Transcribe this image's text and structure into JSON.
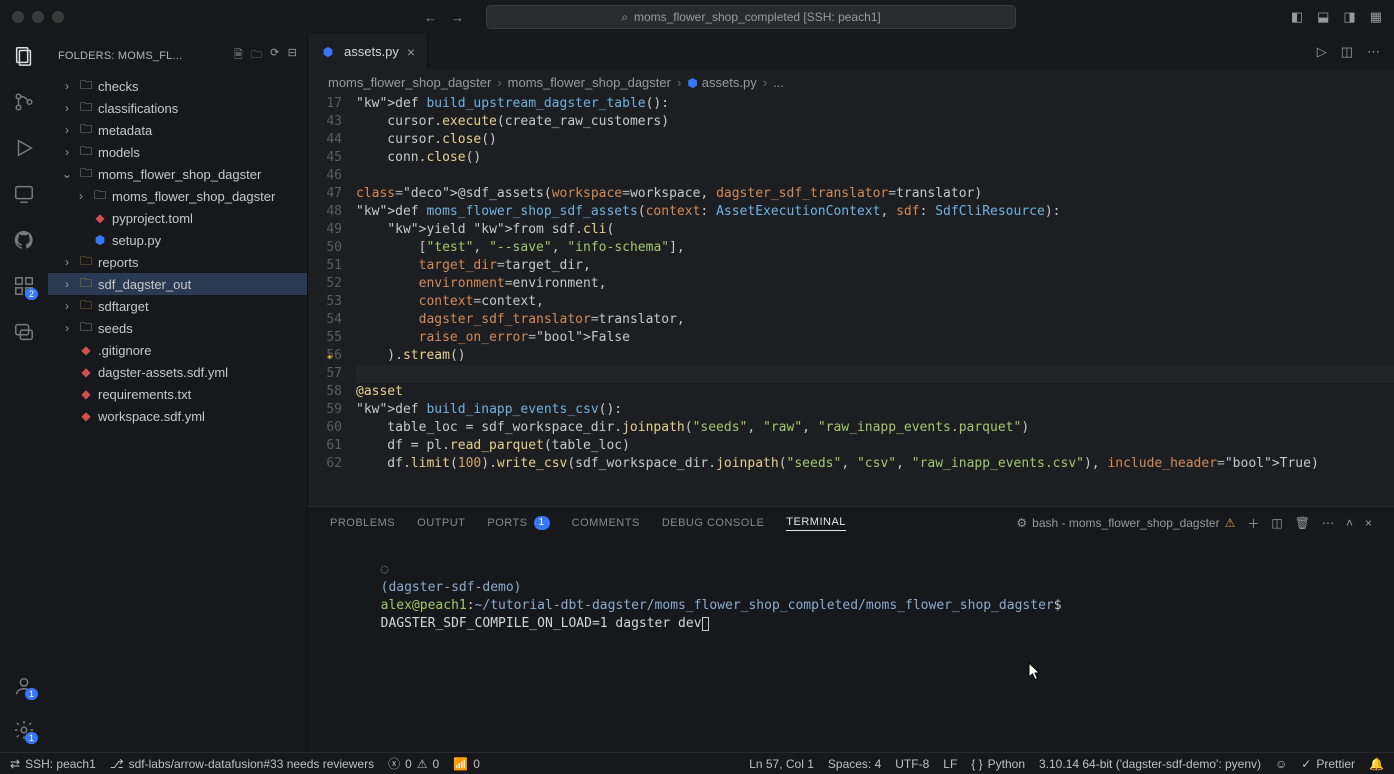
{
  "window": {
    "search_label": "moms_flower_shop_completed [SSH: peach1]"
  },
  "sidebar": {
    "header": "FOLDERS: MOMS_FL...",
    "tree": [
      {
        "indent": 0,
        "chev": "›",
        "icon": "folder",
        "label": "checks"
      },
      {
        "indent": 0,
        "chev": "›",
        "icon": "folder",
        "label": "classifications"
      },
      {
        "indent": 0,
        "chev": "›",
        "icon": "folder",
        "label": "metadata"
      },
      {
        "indent": 0,
        "chev": "›",
        "icon": "folder",
        "label": "models"
      },
      {
        "indent": 0,
        "chev": "⌄",
        "icon": "folder",
        "label": "moms_flower_shop_dagster"
      },
      {
        "indent": 1,
        "chev": "›",
        "icon": "folder",
        "label": "moms_flower_shop_dagster"
      },
      {
        "indent": 1,
        "chev": "",
        "icon": "yml",
        "label": "pyproject.toml"
      },
      {
        "indent": 1,
        "chev": "",
        "icon": "py",
        "label": "setup.py"
      },
      {
        "indent": 0,
        "chev": "›",
        "icon": "folder-y",
        "label": "reports"
      },
      {
        "indent": 0,
        "chev": "›",
        "icon": "folder-y",
        "label": "sdf_dagster_out",
        "selected": true
      },
      {
        "indent": 0,
        "chev": "›",
        "icon": "folder-y",
        "label": "sdftarget"
      },
      {
        "indent": 0,
        "chev": "›",
        "icon": "folder",
        "label": "seeds"
      },
      {
        "indent": 0,
        "chev": "",
        "icon": "yml",
        "label": ".gitignore"
      },
      {
        "indent": 0,
        "chev": "",
        "icon": "yml",
        "label": "dagster-assets.sdf.yml"
      },
      {
        "indent": 0,
        "chev": "",
        "icon": "yml",
        "label": "requirements.txt"
      },
      {
        "indent": 0,
        "chev": "",
        "icon": "yml",
        "label": "workspace.sdf.yml"
      }
    ]
  },
  "tab": {
    "label": "assets.py"
  },
  "breadcrumbs": [
    "moms_flower_shop_dagster",
    "moms_flower_shop_dagster",
    "assets.py",
    "..."
  ],
  "code": {
    "lines": [
      {
        "n": 17,
        "t": "def build_upstream_dagster_table():",
        "cls": "def"
      },
      {
        "n": 43,
        "t": "    cursor.execute(create_raw_customers)"
      },
      {
        "n": 44,
        "t": "    cursor.close()"
      },
      {
        "n": 45,
        "t": "    conn.close()"
      },
      {
        "n": 46,
        "t": ""
      },
      {
        "n": 47,
        "t": "@sdf_assets(workspace=workspace, dagster_sdf_translator=translator)",
        "cls": "deco"
      },
      {
        "n": 48,
        "t": "def moms_flower_shop_sdf_assets(context: AssetExecutionContext, sdf: SdfCliResource):",
        "cls": "def2"
      },
      {
        "n": 49,
        "t": "    yield from sdf.cli("
      },
      {
        "n": 50,
        "t": "        [\"test\", \"--save\", \"info-schema\"],"
      },
      {
        "n": 51,
        "t": "        target_dir=target_dir,"
      },
      {
        "n": 52,
        "t": "        environment=environment,"
      },
      {
        "n": 53,
        "t": "        context=context,"
      },
      {
        "n": 54,
        "t": "        dagster_sdf_translator=translator,"
      },
      {
        "n": 55,
        "t": "        raise_on_error=False"
      },
      {
        "n": 56,
        "t": "    ).stream()",
        "spark": true
      },
      {
        "n": 57,
        "t": "",
        "hl": true
      },
      {
        "n": 58,
        "t": "@asset",
        "cls": "deco2"
      },
      {
        "n": 59,
        "t": "def build_inapp_events_csv():",
        "cls": "def"
      },
      {
        "n": 60,
        "t": "    table_loc = sdf_workspace_dir.joinpath(\"seeds\", \"raw\", \"raw_inapp_events.parquet\")"
      },
      {
        "n": 61,
        "t": "    df = pl.read_parquet(table_loc)"
      },
      {
        "n": 62,
        "t": "    df.limit(100).write_csv(sdf_workspace_dir.joinpath(\"seeds\", \"csv\", \"raw_inapp_events.csv\"), include_header=True)"
      }
    ]
  },
  "panel": {
    "tabs": [
      "PROBLEMS",
      "OUTPUT",
      "PORTS",
      "COMMENTS",
      "DEBUG CONSOLE",
      "TERMINAL"
    ],
    "ports_badge": "1",
    "active": "TERMINAL",
    "terminal_name": "bash - moms_flower_shop_dagster",
    "line": {
      "env": "(dagster-sdf-demo)",
      "user": "alex@peach1",
      "path": "~/tutorial-dbt-dagster/moms_flower_shop_completed/moms_flower_shop_dagster",
      "prompt": "$",
      "cmd": "DAGSTER_SDF_COMPILE_ON_LOAD=1 dagster dev"
    }
  },
  "status": {
    "remote": "SSH: peach1",
    "branch": "sdf-labs/arrow-datafusion#33 needs reviewers",
    "errors": "0",
    "warnings": "0",
    "ports": "0",
    "cursor": "Ln 57, Col 1",
    "spaces": "Spaces: 4",
    "encoding": "UTF-8",
    "eol": "LF",
    "lang": "Python",
    "py_env": "3.10.14 64-bit ('dagster-sdf-demo': pyenv)",
    "prettier": "Prettier"
  },
  "activity_badges": {
    "extensions": "2",
    "accounts": "1",
    "settings": "1"
  }
}
